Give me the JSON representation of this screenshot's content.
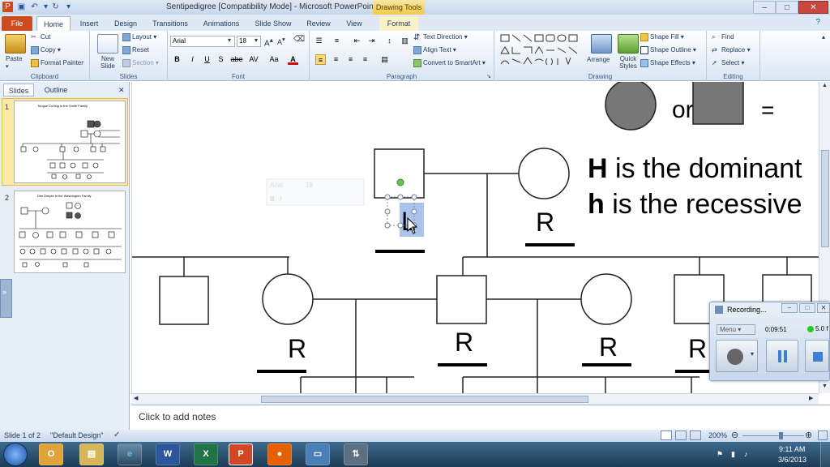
{
  "window": {
    "title": "Sentipedigree [Compatibility Mode]  -  Microsoft PowerPoint",
    "contextual_tab_group": "Drawing Tools"
  },
  "tabs": [
    "File",
    "Home",
    "Insert",
    "Design",
    "Transitions",
    "Animations",
    "Slide Show",
    "Review",
    "View",
    "Format"
  ],
  "active_tab": "Home",
  "ribbon": {
    "clipboard": {
      "label": "Clipboard",
      "paste": "Paste",
      "cut": "Cut",
      "copy": "Copy",
      "format_painter": "Format Painter"
    },
    "slides": {
      "label": "Slides",
      "new_slide": "New Slide",
      "layout": "Layout",
      "reset": "Reset",
      "section": "Section"
    },
    "font": {
      "label": "Font",
      "font_name": "Arial",
      "font_size": "18",
      "bold": "B",
      "italic": "I",
      "underline": "U",
      "shadow": "S",
      "strike": "abe",
      "spacing": "AV",
      "case": "Aa",
      "color": "A"
    },
    "paragraph": {
      "label": "Paragraph",
      "text_direction": "Text Direction",
      "align_text": "Align Text",
      "convert_smartart": "Convert to SmartArt"
    },
    "drawing": {
      "label": "Drawing",
      "arrange": "Arrange",
      "quick_styles": "Quick Styles",
      "shape_fill": "Shape Fill",
      "shape_outline": "Shape Outline",
      "shape_effects": "Shape Effects"
    },
    "editing": {
      "label": "Editing",
      "find": "Find",
      "replace": "Replace",
      "select": "Select"
    }
  },
  "left_pane": {
    "tabs": [
      "Slides",
      "Outline"
    ],
    "thumbnails": [
      {
        "number": "1",
        "caption": "Tongue  Curling in the Smith Family"
      },
      {
        "number": "2",
        "caption": "Dim Dimple  in the Washington Family"
      }
    ]
  },
  "slide": {
    "legend_or": "or",
    "legend_equals": "=",
    "dominant_letter": "H",
    "dominant_text": " is the dominant",
    "recessive_letter": "h",
    "recessive_text": " is the recessive",
    "typed_letter": "L",
    "genotype_labels": [
      "R",
      "R",
      "R",
      "R",
      "R"
    ]
  },
  "notes_placeholder": "Click to add notes",
  "status": {
    "slide_indicator": "Slide 1 of 2",
    "theme": "\"Default Design\"",
    "zoom": "200%"
  },
  "recording_widget": {
    "title": "Recording...",
    "menu": "Menu",
    "elapsed": "0:09:51",
    "fps": "5.0 f"
  },
  "taskbar": {
    "time": "9:11 AM",
    "date": "3/6/2013",
    "apps": [
      "Outlook",
      "Explorer",
      "Internet Explorer",
      "Word",
      "Excel",
      "PowerPoint",
      "Firefox",
      "Remote Desktop",
      "Network"
    ]
  },
  "colors": {
    "file_tab": "#d04a20",
    "affected_fill": "#777777",
    "taskbar": "#1c3b55",
    "recording_dot": "#22cc22"
  }
}
